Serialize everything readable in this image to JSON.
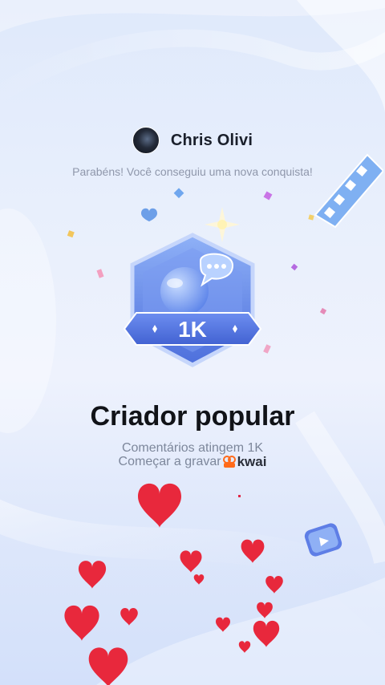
{
  "user": {
    "name": "Chris Olivi"
  },
  "subtitle": "Parabéns! Você conseguiu uma nova conquista!",
  "badge": {
    "label": "1K"
  },
  "achievement": {
    "title": "Criador popular",
    "description": "Comentários atingem 1K",
    "record_text": "Começar a gravar",
    "brand": "kwai"
  },
  "colors": {
    "accent": "#5e7ee6",
    "heart": "#e8283c",
    "brand": "#ff6a1a"
  }
}
